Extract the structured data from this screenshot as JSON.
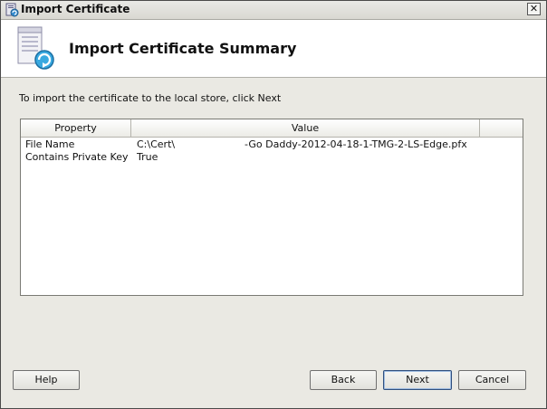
{
  "window": {
    "title": "Import Certificate",
    "close_glyph": "✕"
  },
  "header": {
    "title": "Import Certificate Summary",
    "icon": "certificate-import-icon"
  },
  "instruction": "To import the certificate to the local store, click Next",
  "listview": {
    "columns": [
      "Property",
      "Value"
    ],
    "rows": [
      {
        "property": "File Name",
        "value_part1": "C:\\Cert\\",
        "value_part2": "-Go Daddy-2012-04-18-1-TMG-2-LS-Edge.pfx"
      },
      {
        "property": "Contains Private Key",
        "value_part1": "True",
        "value_part2": ""
      }
    ]
  },
  "buttons": {
    "help": "Help",
    "back": "Back",
    "next": "Next",
    "cancel": "Cancel"
  }
}
